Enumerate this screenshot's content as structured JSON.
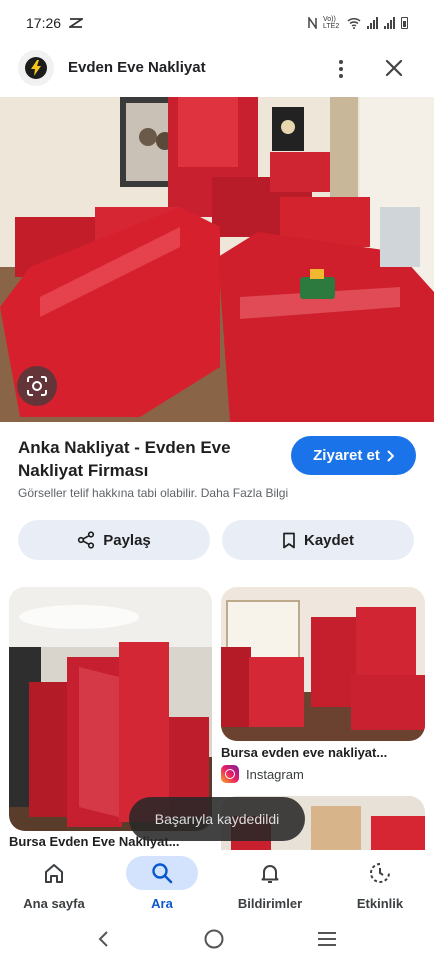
{
  "status_bar": {
    "time": "17:26",
    "network_label": "Vo)) LTE2"
  },
  "header": {
    "site_name": "Evden Eve Nakliyat"
  },
  "result": {
    "title": "Anka Nakliyat - Evden Eve Nakliyat Firması",
    "visit_label": "Ziyaret et",
    "copyright_notice": "Görseller telif hakkına tabi olabilir. Daha Fazla Bilgi"
  },
  "actions": {
    "share_label": "Paylaş",
    "save_label": "Kaydet"
  },
  "related": [
    {
      "caption": "Bursa Evden Eve Nakliyat..."
    },
    {
      "caption": "Bursa evden eve nakliyat...",
      "source": "Instagram"
    }
  ],
  "toast": {
    "message": "Başarıyla kaydedildi"
  },
  "bottom_nav": [
    {
      "label": "Ana sayfa",
      "icon": "home-icon",
      "active": false
    },
    {
      "label": "Ara",
      "icon": "search-icon",
      "active": true
    },
    {
      "label": "Bildirimler",
      "icon": "bell-icon",
      "active": false
    },
    {
      "label": "Etkinlik",
      "icon": "activity-icon",
      "active": false
    }
  ],
  "colors": {
    "accent": "#1a73e8",
    "active_nav": "#0b57d0",
    "active_nav_bg": "#d3e3fd",
    "chip_bg": "#e9eef6",
    "wrap_red": "#d8202e"
  }
}
